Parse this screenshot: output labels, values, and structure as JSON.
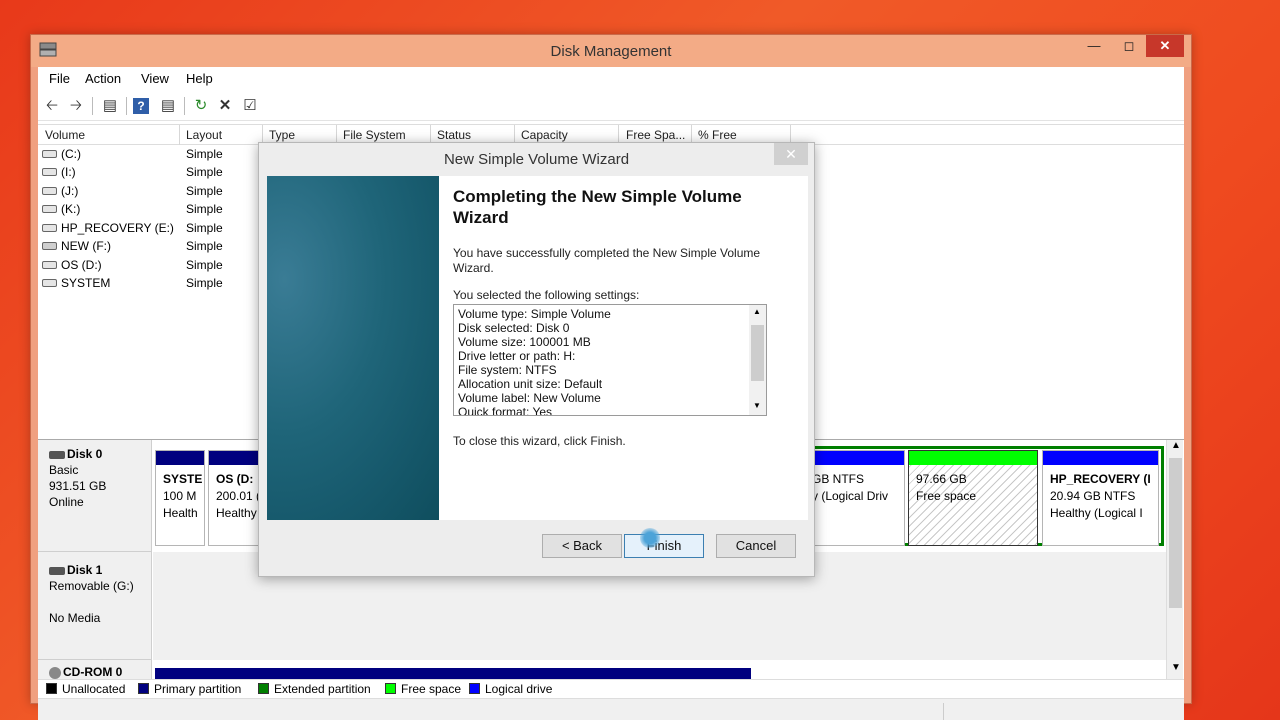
{
  "window": {
    "title": "Disk Management"
  },
  "menu": [
    "File",
    "Action",
    "View",
    "Help"
  ],
  "volume_list": {
    "columns": [
      "Volume",
      "Layout",
      "Type",
      "File System",
      "Status",
      "Capacity",
      "Free Spa...",
      "% Free"
    ],
    "rows": [
      {
        "name": "(C:)",
        "layout": "Simple"
      },
      {
        "name": "(I:)",
        "layout": "Simple"
      },
      {
        "name": "(J:)",
        "layout": "Simple"
      },
      {
        "name": "(K:)",
        "layout": "Simple"
      },
      {
        "name": "HP_RECOVERY (E:)",
        "layout": "Simple"
      },
      {
        "name": "NEW (F:)",
        "layout": "Simple"
      },
      {
        "name": "OS (D:)",
        "layout": "Simple"
      },
      {
        "name": "SYSTEM",
        "layout": "Simple"
      }
    ]
  },
  "disks": [
    {
      "name": "Disk 0",
      "type": "Basic",
      "size": "931.51 GB",
      "status": "Online",
      "partitions": [
        {
          "title": "SYSTE",
          "line1": "100 M",
          "line2": "Health"
        },
        {
          "title": "OS  (D:",
          "line1": "200.01 (",
          "line2": "Healthy"
        },
        {
          "title": "",
          "line1": "GB NTFS",
          "line2": "y (Logical Driv"
        },
        {
          "title": "",
          "line1": "97.66 GB",
          "line2": "Free space"
        },
        {
          "title": "HP_RECOVERY  (I",
          "line1": "20.94 GB NTFS",
          "line2": "Healthy (Logical I"
        }
      ]
    },
    {
      "name": "Disk 1",
      "type": "Removable (G:)",
      "status": "No Media"
    },
    {
      "name": "CD-ROM 0"
    }
  ],
  "legend": [
    {
      "label": "Unallocated",
      "color": "#000000"
    },
    {
      "label": "Primary partition",
      "color": "#00007f"
    },
    {
      "label": "Extended partition",
      "color": "#007f00"
    },
    {
      "label": "Free space",
      "color": "#00ff00"
    },
    {
      "label": "Logical drive",
      "color": "#0000ff"
    }
  ],
  "wizard": {
    "title": "New Simple Volume Wizard",
    "heading": "Completing the New Simple Volume Wizard",
    "message": "You have successfully completed the New Simple Volume Wizard.",
    "settings_label": "You selected the following settings:",
    "settings": [
      "Volume type: Simple Volume",
      "Disk selected: Disk 0",
      "Volume size: 100001 MB",
      "Drive letter or path: H:",
      "File system: NTFS",
      "Allocation unit size: Default",
      "Volume label: New Volume",
      "Quick format: Yes"
    ],
    "close_message": "To close this wizard, click Finish.",
    "buttons": {
      "back": "< Back",
      "finish": "Finish",
      "cancel": "Cancel"
    }
  }
}
